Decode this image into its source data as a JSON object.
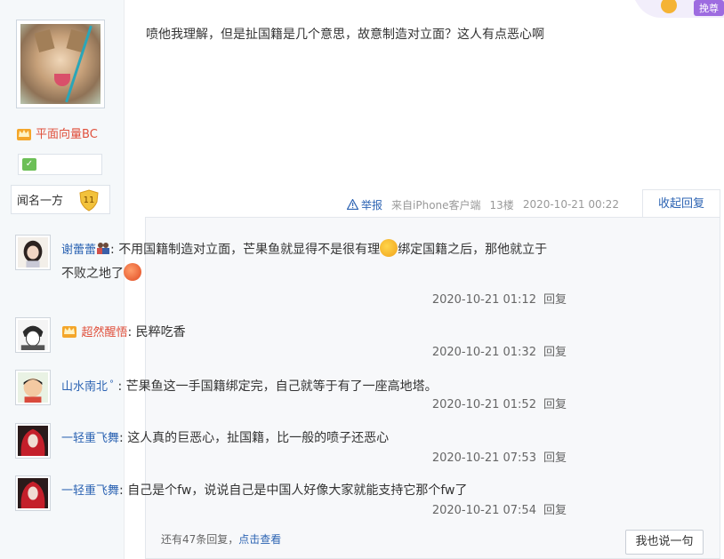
{
  "author": {
    "name": "平面向量BC",
    "level_name": "闻名一方",
    "level_num": "11"
  },
  "post": {
    "content": "喷他我理解，但是扯国籍是几个意思，故意制造对立面？这人有点恶心啊",
    "report_label": "举报",
    "client": "来自iPhone客户端",
    "floor": "13楼",
    "time": "2020-10-21 00:22",
    "collapse_label": "收起回复"
  },
  "top_badge": {
    "label": "挽尊"
  },
  "replies": [
    {
      "user": "谢蕾蕾",
      "text_part1": "不用国籍制造对立面，芒果鱼就显得不是很有理",
      "text_part2": "绑定国籍之后，那他就立于不败之地了",
      "time": "2020-10-21 01:12",
      "reply_label": "回复"
    },
    {
      "user": "超然醒悟",
      "text": "民粹吃香",
      "time": "2020-10-21 01:32",
      "reply_label": "回复"
    },
    {
      "user": "山水南北",
      "text": "芒果鱼这一手国籍绑定完，自己就等于有了一座高地塔。",
      "time": "2020-10-21 01:52",
      "reply_label": "回复"
    },
    {
      "user": "一轻重飞舞",
      "text": "这人真的巨恶心，扯国籍，比一般的喷子还恶心",
      "time": "2020-10-21 07:53",
      "reply_label": "回复"
    },
    {
      "user": "一轻重飞舞",
      "text": "自己是个fw，说说自己是中国人好像大家就能支持它那个fw了",
      "time": "2020-10-21 07:54",
      "reply_label": "回复"
    }
  ],
  "footer": {
    "more_text": "还有47条回复，",
    "more_link": "点击查看",
    "say_button": "我也说一句"
  },
  "colors": {
    "link_blue": "#2d64b3",
    "vip_red": "#e0503c"
  }
}
